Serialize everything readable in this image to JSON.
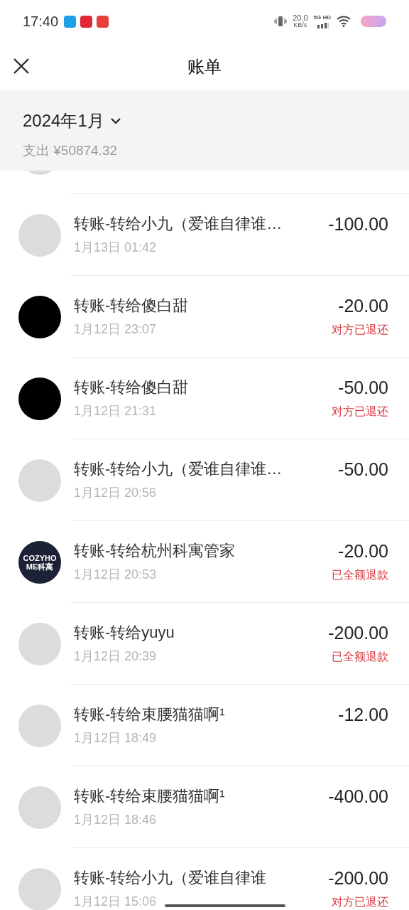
{
  "status_bar": {
    "time": "17:40",
    "speed": "20.0",
    "speed_unit": "KB/s",
    "network": "5G HD"
  },
  "nav": {
    "title": "账单"
  },
  "summary": {
    "month": "2024年1月",
    "expense": "支出 ¥50874.32"
  },
  "rows": [
    {
      "kind": "photo",
      "title": "",
      "date": "",
      "amount": "",
      "status": ""
    },
    {
      "kind": "photo",
      "title": "转账-转给小九（爱谁自律谁…",
      "date": "1月13日 01:42",
      "amount": "-100.00",
      "status": ""
    },
    {
      "kind": "black",
      "title": "转账-转给傻白甜",
      "date": "1月12日 23:07",
      "amount": "-20.00",
      "status": "对方已退还"
    },
    {
      "kind": "black",
      "title": "转账-转给傻白甜",
      "date": "1月12日 21:31",
      "amount": "-50.00",
      "status": "对方已退还"
    },
    {
      "kind": "photo",
      "title": "转账-转给小九（爱谁自律谁…",
      "date": "1月12日 20:56",
      "amount": "-50.00",
      "status": ""
    },
    {
      "kind": "logo",
      "logo_text": "COZYHOME科寓",
      "title": "转账-转给杭州科寓管家",
      "date": "1月12日 20:53",
      "amount": "-20.00",
      "status": "已全额退款"
    },
    {
      "kind": "photo",
      "title": "转账-转给yuyu",
      "date": "1月12日 20:39",
      "amount": "-200.00",
      "status": "已全额退款"
    },
    {
      "kind": "photo",
      "title": "转账-转给束腰猫猫啊¹",
      "date": "1月12日 18:49",
      "amount": "-12.00",
      "status": ""
    },
    {
      "kind": "photo",
      "title": "转账-转给束腰猫猫啊¹",
      "date": "1月12日 18:46",
      "amount": "-400.00",
      "status": ""
    },
    {
      "kind": "photo",
      "title": "转账-转给小九（爱谁自律谁",
      "date": "1月12日 15:06",
      "amount": "-200.00",
      "status": "对方已退还"
    }
  ]
}
